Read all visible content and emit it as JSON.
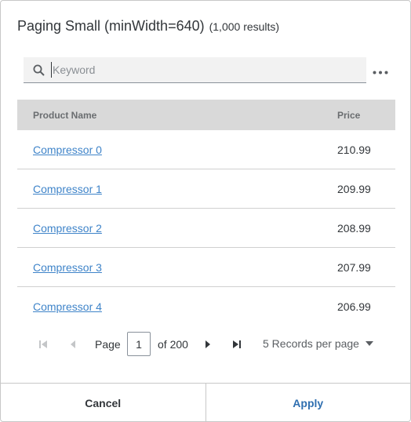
{
  "dialog": {
    "title": "Paging Small (minWidth=640)",
    "result_count": "(1,000 results)"
  },
  "search": {
    "placeholder": "Keyword",
    "icon": "search-icon"
  },
  "toolbar": {
    "more_icon": "more-icon"
  },
  "table": {
    "columns": {
      "name": "Product Name",
      "price": "Price"
    },
    "rows": [
      {
        "name": "Compressor 0",
        "price": "210.99"
      },
      {
        "name": "Compressor 1",
        "price": "209.99"
      },
      {
        "name": "Compressor 2",
        "price": "208.99"
      },
      {
        "name": "Compressor 3",
        "price": "207.99"
      },
      {
        "name": "Compressor 4",
        "price": "206.99"
      }
    ]
  },
  "pager": {
    "page_label": "Page",
    "current_page": "1",
    "of_label": "of 200",
    "records_per_page": "5 Records per page"
  },
  "footer": {
    "cancel_label": "Cancel",
    "apply_label": "Apply"
  },
  "colors": {
    "link": "#3f84c9",
    "apply": "#2f6fb0",
    "header_bg": "#d9d9d9"
  }
}
